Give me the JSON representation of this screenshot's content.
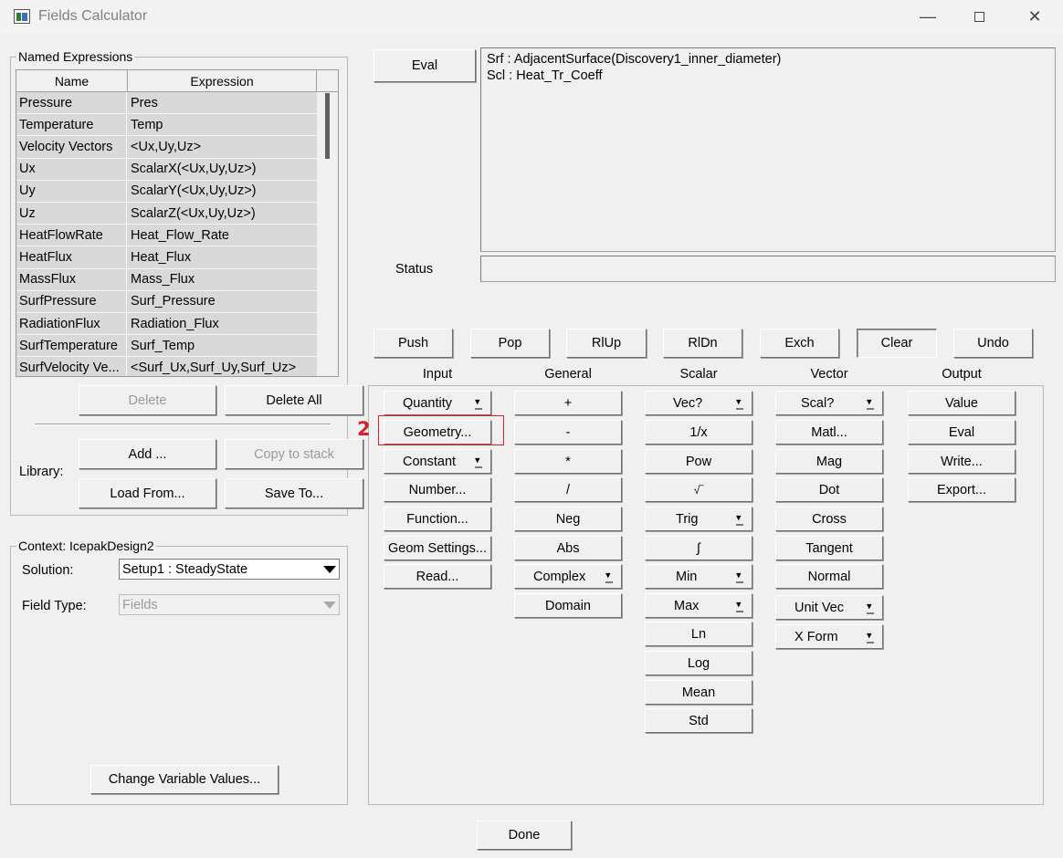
{
  "window": {
    "title": "Fields Calculator"
  },
  "named_expressions": {
    "legend": "Named Expressions",
    "columns": [
      "Name",
      "Expression"
    ],
    "rows": [
      [
        "Pressure",
        "Pres"
      ],
      [
        "Temperature",
        "Temp"
      ],
      [
        "Velocity Vectors",
        "<Ux,Uy,Uz>"
      ],
      [
        "Ux",
        "ScalarX(<Ux,Uy,Uz>)"
      ],
      [
        "Uy",
        "ScalarY(<Ux,Uy,Uz>)"
      ],
      [
        "Uz",
        "ScalarZ(<Ux,Uy,Uz>)"
      ],
      [
        "HeatFlowRate",
        "Heat_Flow_Rate"
      ],
      [
        "HeatFlux",
        "Heat_Flux"
      ],
      [
        "MassFlux",
        "Mass_Flux"
      ],
      [
        "SurfPressure",
        "Surf_Pressure"
      ],
      [
        "RadiationFlux",
        "Radiation_Flux"
      ],
      [
        "SurfTemperature",
        "Surf_Temp"
      ],
      [
        "SurfVelocity Ve...",
        "<Surf_Ux,Surf_Uy,Surf_Uz>"
      ]
    ],
    "delete_label": "Delete",
    "delete_all_label": "Delete All",
    "library_label": "Library:",
    "add_label": "Add ...",
    "copy_to_stack_label": "Copy to stack",
    "load_from_label": "Load From...",
    "save_to_label": "Save To..."
  },
  "context": {
    "legend": "Context: IcepakDesign2",
    "solution_label": "Solution:",
    "solution_value": "Setup1 : SteadyState",
    "field_type_label": "Field Type:",
    "field_type_value": "Fields",
    "change_vars_label": "Change Variable Values..."
  },
  "stack": {
    "eval_label": "Eval",
    "lines": [
      "Srf : AdjacentSurface(Discovery1_inner_diameter)",
      "Scl : Heat_Tr_Coeff"
    ],
    "status_label": "Status",
    "status_value": ""
  },
  "stack_ops": [
    "Push",
    "Pop",
    "RlUp",
    "RlDn",
    "Exch",
    "Clear",
    "Undo"
  ],
  "sections": {
    "input": {
      "header": "Input",
      "buttons": [
        "Quantity",
        "Geometry...",
        "Constant",
        "Number...",
        "Function...",
        "Geom Settings...",
        "Read..."
      ]
    },
    "general": {
      "header": "General",
      "buttons": [
        "+",
        "-",
        "*",
        "/",
        "Neg",
        "Abs",
        "Complex",
        "Domain"
      ]
    },
    "scalar": {
      "header": "Scalar",
      "buttons": [
        "Vec?",
        "1/x",
        "Pow",
        "√‾",
        "Trig",
        "∫",
        "Min",
        "Max",
        "Ln",
        "Log",
        "Mean",
        "Std"
      ]
    },
    "vector": {
      "header": "Vector",
      "buttons": [
        "Scal?",
        "Matl...",
        "Mag",
        "Dot",
        "Cross",
        "Tangent",
        "Normal",
        "Unit Vec",
        "X Form"
      ]
    },
    "output": {
      "header": "Output",
      "buttons": [
        "Value",
        "Eval",
        "Write...",
        "Export..."
      ]
    }
  },
  "annotation": {
    "step_number": "2",
    "color": "#d3202a"
  },
  "done_label": "Done"
}
